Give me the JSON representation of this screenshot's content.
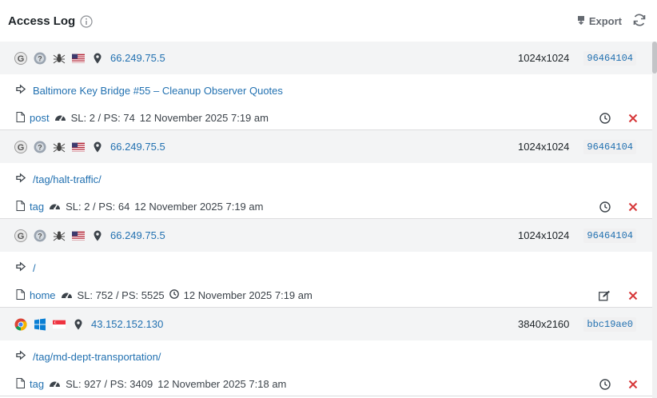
{
  "header": {
    "title": "Access Log",
    "export_label": "Export"
  },
  "colors": {
    "link": "#2271b1",
    "delete": "#d63638"
  },
  "entries": [
    {
      "browser_icon": "google-icon",
      "os_icon": "unknown-os-icon",
      "bot_icon": "bot-spider-icon",
      "flag_icon": "us-flag-icon",
      "ip": "66.249.75.5",
      "resolution": "1024x1024",
      "uid": "96464104",
      "url": "Baltimore Key Bridge #55 – Cleanup Observer Quotes",
      "type": "post",
      "stats": "SL: 2 / PS: 74",
      "time": "12 November 2025 7:19 am",
      "action_icon": "clock-icon"
    },
    {
      "browser_icon": "google-icon",
      "os_icon": "unknown-os-icon",
      "bot_icon": "bot-spider-icon",
      "flag_icon": "us-flag-icon",
      "ip": "66.249.75.5",
      "resolution": "1024x1024",
      "uid": "96464104",
      "url": "/tag/halt-traffic/",
      "type": "tag",
      "stats": "SL: 2 / PS: 64",
      "time": "12 November 2025 7:19 am",
      "action_icon": "clock-icon"
    },
    {
      "browser_icon": "google-icon",
      "os_icon": "unknown-os-icon",
      "bot_icon": "bot-spider-icon",
      "flag_icon": "us-flag-icon",
      "ip": "66.249.75.5",
      "resolution": "1024x1024",
      "uid": "96464104",
      "url": "/",
      "type": "home",
      "stats": "SL: 752 / PS: 5525",
      "time": "12 November 2025 7:19 am",
      "action_icon": "edit-icon"
    },
    {
      "browser_icon": "chrome-icon",
      "os_icon": "windows-icon",
      "bot_icon": "",
      "flag_icon": "sg-flag-icon",
      "ip": "43.152.152.130",
      "resolution": "3840x2160",
      "uid": "bbc19ae0",
      "url": "/tag/md-dept-transportation/",
      "type": "tag",
      "stats": "SL: 927 / PS: 3409",
      "time": "12 November 2025 7:18 am",
      "action_icon": "clock-icon"
    }
  ]
}
